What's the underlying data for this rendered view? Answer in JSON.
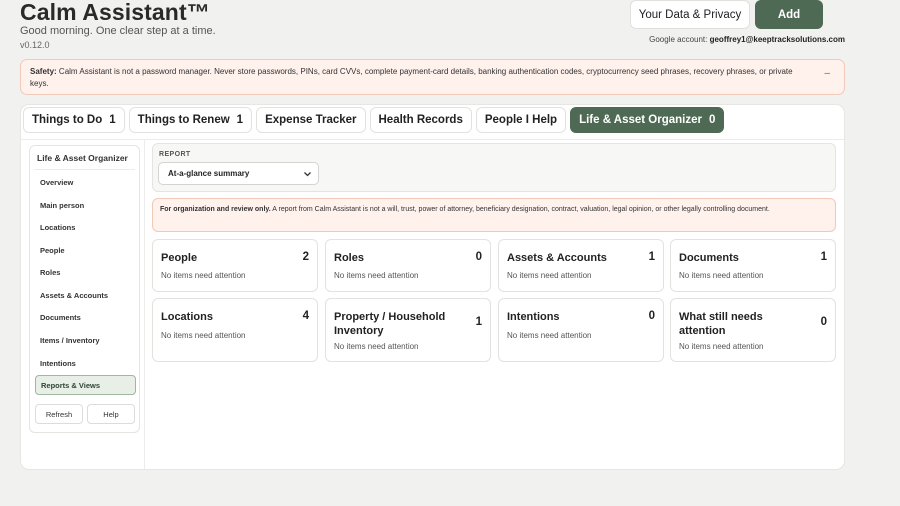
{
  "app": {
    "title": "Calm Assistant™",
    "subtitle": "Good morning. One clear step at a time.",
    "version": "v0.12.0"
  },
  "header": {
    "privacy_label": "Your Data & Privacy",
    "add_label": "Add",
    "account_prefix": "Google account:",
    "account_email": "geoffrey1@keeptracksolutions.com"
  },
  "safety": {
    "label": "Safety:",
    "text": "Calm Assistant is not a password manager. Never store passwords, PINs, card CVVs, complete payment-card details, banking authentication codes, cryptocurrency seed phrases, recovery phrases, or private keys.",
    "dismiss": "–"
  },
  "tabs": [
    {
      "label": "Things to Do",
      "count": "1"
    },
    {
      "label": "Things to Renew",
      "count": "1"
    },
    {
      "label": "Expense Tracker",
      "count": ""
    },
    {
      "label": "Health Records",
      "count": ""
    },
    {
      "label": "People I Help",
      "count": ""
    },
    {
      "label": "Life & Asset Organizer",
      "count": "0"
    }
  ],
  "sidebar": {
    "title": "Life & Asset Organizer",
    "items": [
      {
        "label": "Overview"
      },
      {
        "label": "Main person"
      },
      {
        "label": "Locations"
      },
      {
        "label": "People"
      },
      {
        "label": "Roles"
      },
      {
        "label": "Assets & Accounts"
      },
      {
        "label": "Documents"
      },
      {
        "label": "Items / Inventory"
      },
      {
        "label": "Intentions"
      },
      {
        "label": "Reports & Views"
      }
    ],
    "active_index": 9,
    "refresh_label": "Refresh",
    "help_label": "Help"
  },
  "report": {
    "label": "REPORT",
    "selected": "At-a-glance summary"
  },
  "notice": {
    "label": "For organization and review only.",
    "text": "A report from Calm Assistant is not a will, trust, power of attorney, beneficiary designation, contract, valuation, legal opinion, or other legally controlling document."
  },
  "cards": [
    {
      "title": "People",
      "count": "2",
      "status": "No items need attention"
    },
    {
      "title": "Roles",
      "count": "0",
      "status": "No items need attention"
    },
    {
      "title": "Assets & Accounts",
      "count": "1",
      "status": "No items need attention"
    },
    {
      "title": "Documents",
      "count": "1",
      "status": "No items need attention"
    },
    {
      "title": "Locations",
      "count": "4",
      "status": "No items need attention"
    },
    {
      "title": "Property / Household Inventory",
      "count": "1",
      "status": "No items need attention"
    },
    {
      "title": "Intentions",
      "count": "0",
      "status": "No items need attention"
    },
    {
      "title": "What still needs attention",
      "count": "0",
      "status": "No items need attention"
    }
  ],
  "colors": {
    "accent": "#4f6a54",
    "warning_bg": "#fff1ec",
    "warning_border": "#f1c9b9"
  }
}
